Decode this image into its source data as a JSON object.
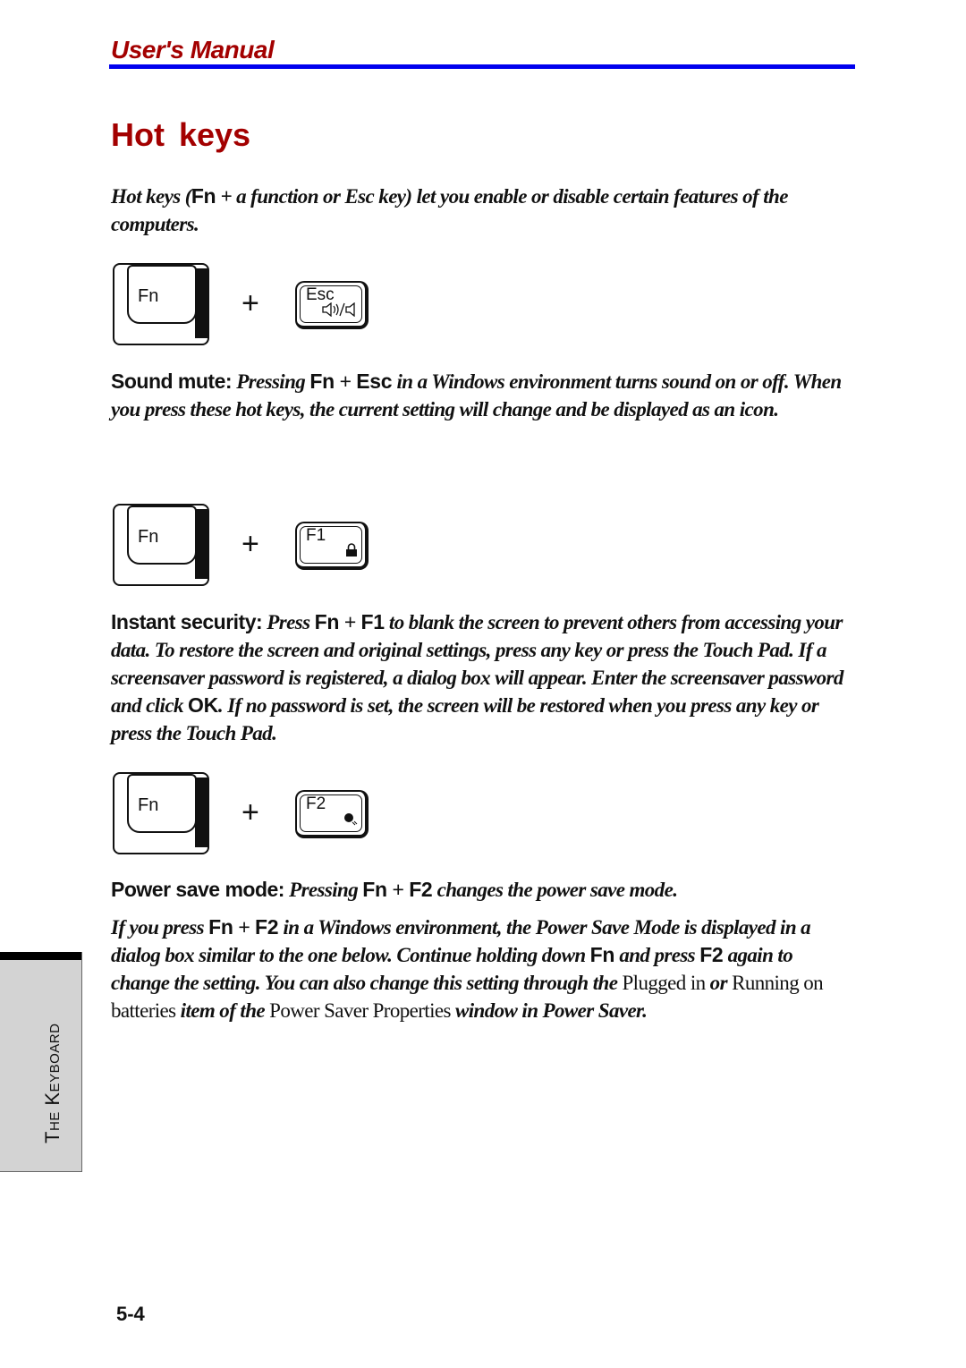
{
  "header": {
    "title": "User's Manual",
    "rule_color": "#0000ee",
    "title_color": "#a30000"
  },
  "section": {
    "title": "Hot keys"
  },
  "intro": {
    "t1": "Hot keys (",
    "t2": "Fn",
    "t3": " + a function or Esc key) let you enable or disable certain features of the computers."
  },
  "hotkeys": [
    {
      "key1": "Fn",
      "plus": "+",
      "key2": "Esc",
      "key2_icon": "speaker-on-off-icon",
      "key2_glyph": "🔈/🔇",
      "lead": "Sound mute:",
      "t1": " Pressing ",
      "k1": "Fn",
      "p": " + ",
      "k2": "Esc",
      "t2": " in a Windows environment turns sound on or off. When you press these hot keys, the current setting will change and be displayed as an icon."
    },
    {
      "key1": "Fn",
      "plus": "+",
      "key2": "F1",
      "key2_icon": "lock-icon",
      "key2_glyph": "🔒",
      "lead": "Instant security:",
      "t1": " Press ",
      "k1": "Fn",
      "p": " + ",
      "k2": "F1",
      "t2": " to blank the screen to prevent others from accessing your data. To restore the screen and original settings, press any key or press the Touch Pad. If a screensaver password is registered, a dialog box will appear. Enter the screensaver password and click ",
      "ok": "OK",
      "t3": ". If no password is set, the screen will be restored when you press any key or press the Touch Pad."
    },
    {
      "key1": "Fn",
      "plus": "+",
      "key2": "F2",
      "key2_icon": "power-save-bulb-icon",
      "key2_glyph": "●",
      "lead": "Power save mode:",
      "t1": " Pressing ",
      "k1": "Fn",
      "p": " + ",
      "k2": "F2",
      "t2": " changes the power save mode."
    }
  ],
  "power_detail": {
    "t1": "If you press ",
    "k1": "Fn",
    "p": " + ",
    "k2": "F2",
    "t2": " in a Windows environment, the Power Save Mode is displayed in a dialog box similar to the one below. Continue holding down ",
    "k3": "Fn",
    "t3": " and press ",
    "k4": "F2",
    "t4": " again to change the setting. You can also change this setting through the ",
    "r1": "Plugged in",
    "t5": " or ",
    "r2": "Running on batteries",
    "t6": " item of the ",
    "r3": "Power Saver Properties",
    "t7": " window in Power Saver."
  },
  "side_tab": {
    "label": "The Keyboard"
  },
  "footer": {
    "page_number": "5-4"
  }
}
